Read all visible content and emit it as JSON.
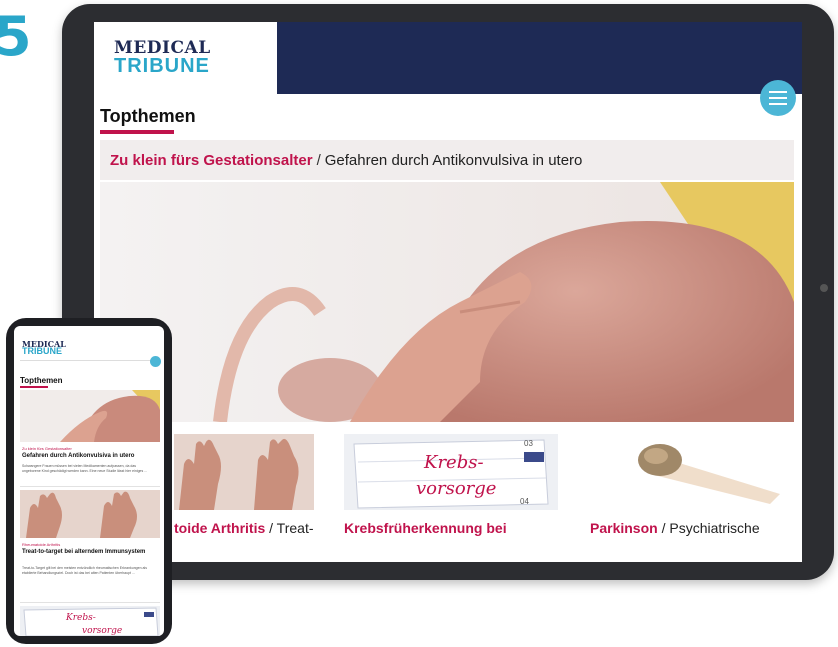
{
  "corner_digit": "5",
  "brand": {
    "line1": "MEDICAL",
    "line2": "TRIBUNE"
  },
  "section_title": "Topthemen",
  "lead": {
    "kicker": "Zu klein fürs Gestationsalter",
    "separator": "/",
    "title": "Gefahren durch Antikonvulsiva in utero"
  },
  "cards": [
    {
      "kicker": "toide Arthritis",
      "separator": " /",
      "rest": " Treat-"
    },
    {
      "kicker": "Krebsfrüherkennung bei",
      "separator": "",
      "rest": ""
    },
    {
      "kicker": "Parkinson",
      "separator": " /",
      "rest": " Psychiatrische"
    }
  ],
  "card_image_text": {
    "line1": "Krebs-",
    "line2": "vorsorge",
    "date_top": "03",
    "date_bottom": "04"
  },
  "phone": {
    "article1": {
      "kicker": "Zu klein fürs Gestationsalter",
      "title": "Gefahren durch Antikonvulsiva in utero",
      "body": "Schwangere Frauen müssen bei vielen Medikamenten aufpassen, da das ungeborene Kind geschädigt werden kann. Eine neue Studie lässt hier einiges ..."
    },
    "article2": {
      "kicker": "Rheumatoide Arthritis",
      "title": "Treat-to-target bei alterndem Immunsystem",
      "body": "Treat-to-Target gilt bei den meisten entzündlich rheumatischen Erkrankungen als etablierte Behandlungsziel. Doch ist das bei alten Patienten überhaupt ..."
    },
    "bottom_image_text": {
      "line1": "Krebs-",
      "line2": "vorsorge"
    }
  },
  "colors": {
    "navy": "#1e2a55",
    "teal": "#2aa6c9",
    "accent": "#c0134c"
  },
  "icons": {
    "menu": "hamburger-menu-icon"
  }
}
